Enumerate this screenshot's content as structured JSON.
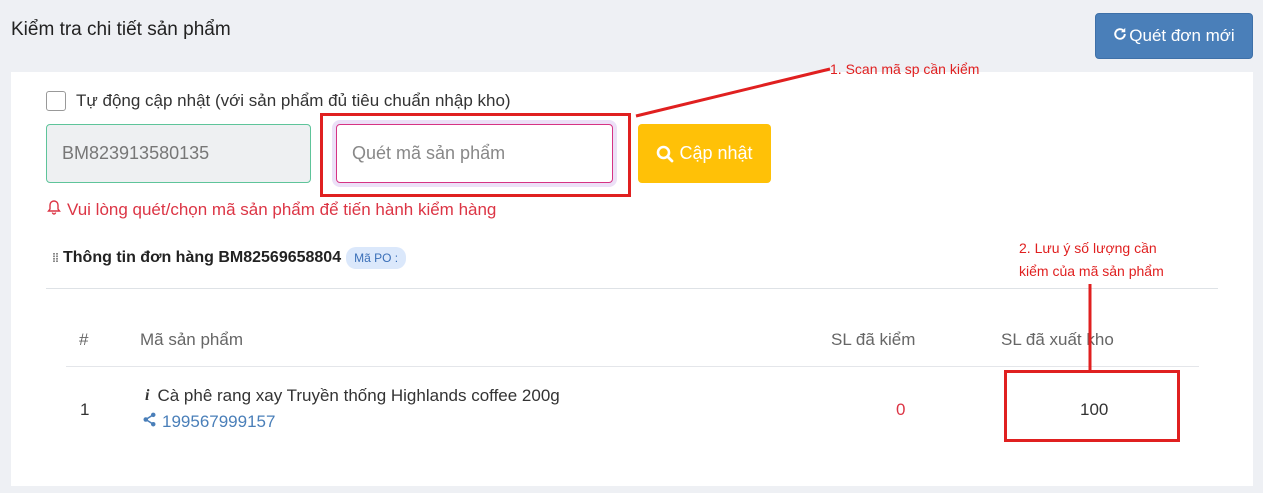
{
  "header": {
    "title": "Kiểm tra chi tiết sản phẩm",
    "new_scan_label": "Quét đơn mới"
  },
  "form": {
    "auto_update_label": "Tự động cập nhật (với sản phẩm đủ tiêu chuẩn nhập kho)",
    "auto_update_checked": false,
    "order_code_value": "BM823913580135",
    "scan_placeholder": "Quét mã sản phẩm",
    "update_button_label": "Cập nhật",
    "warning_text": "Vui lòng quét/chọn mã sản phẩm để tiến hành kiểm hàng"
  },
  "order_info": {
    "title": "Thông tin đơn hàng BM82569658804",
    "po_badge": "Mã PO :"
  },
  "table": {
    "columns": [
      "#",
      "Mã sản phẩm",
      "SL đã kiểm",
      "SL đã xuất kho"
    ],
    "rows": [
      {
        "index": "1",
        "product_name": "Cà phê rang xay Truyền thống Highlands coffee 200g",
        "info_icon": "i",
        "sku": "199567999157",
        "checked_qty": "0",
        "exported_qty": "100"
      }
    ]
  },
  "annotations": {
    "step1": "1. Scan mã sp cần kiểm",
    "step2_line1": "2. Lưu ý số lượng cần",
    "step2_line2": "kiểm của mã sản phẩm"
  },
  "icons": {
    "refresh": "refresh-icon",
    "search": "search-icon",
    "bell": "bell-icon",
    "share": "share-icon",
    "grip": "grip-icon"
  },
  "colors": {
    "primary": "#4a7fb9",
    "warning": "#ffc107",
    "danger": "#dc3545",
    "annotation": "#e02020",
    "focus_border": "#d63384"
  }
}
